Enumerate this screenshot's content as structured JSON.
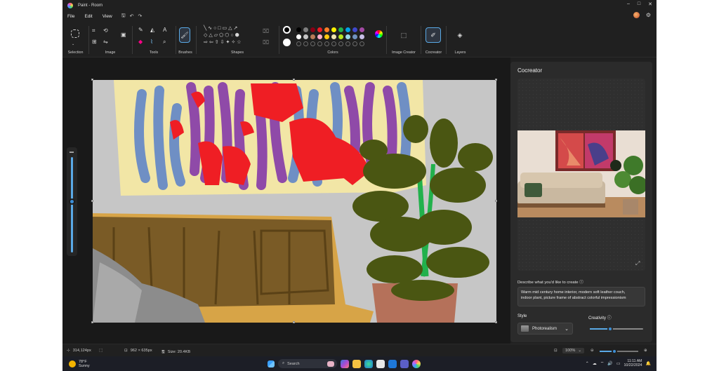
{
  "window": {
    "title": "Paint - Room",
    "controls": [
      "minimize-icon",
      "maximize-icon",
      "close-icon"
    ]
  },
  "menu": {
    "file": "File",
    "edit": "Edit",
    "view": "View"
  },
  "ribbon": {
    "selection_label": "Selection",
    "image_label": "Image",
    "tools_label": "Tools",
    "brushes_label": "Brushes",
    "shapes_label": "Shapes",
    "colors_label": "Colors",
    "image_creator_label": "Image Creator",
    "cocreator_label": "Cocreator",
    "layers_label": "Layers",
    "palette_row1": [
      "#000000",
      "#7f7f7f",
      "#880015",
      "#ed1c24",
      "#ff7f27",
      "#fff200",
      "#22b14c",
      "#00a2e8",
      "#3f48cc",
      "#a349a4"
    ],
    "palette_row2": [
      "#ffffff",
      "#c3c3c3",
      "#b97a57",
      "#ffaec9",
      "#ffc90e",
      "#efe4b0",
      "#b5e61d",
      "#99d9ea",
      "#7092be",
      "#c8bfe7"
    ],
    "primary_color": "#000000",
    "secondary_color": "#ffffff"
  },
  "cocreator": {
    "title": "Cocreator",
    "prompt_label": "Describe what you'd like to create",
    "prompt_text": "Warm mid century home interior, modern soft leather couch,\nindoor plant, picture frame of abstract colorful impressionism",
    "style_label": "Style",
    "style_value": "Photorealism",
    "creativity_label": "Creativity",
    "creativity_level": 0.38
  },
  "status": {
    "cursor_pos": "314,124px",
    "canvas_size": "962 × 635px",
    "file_size": "Size: 20.4KB",
    "zoom": "100%"
  },
  "taskbar": {
    "weather_temp": "78°F",
    "weather_desc": "Sunny",
    "search_placeholder": "Search",
    "time": "11:11 AM",
    "date": "10/22/2024"
  }
}
